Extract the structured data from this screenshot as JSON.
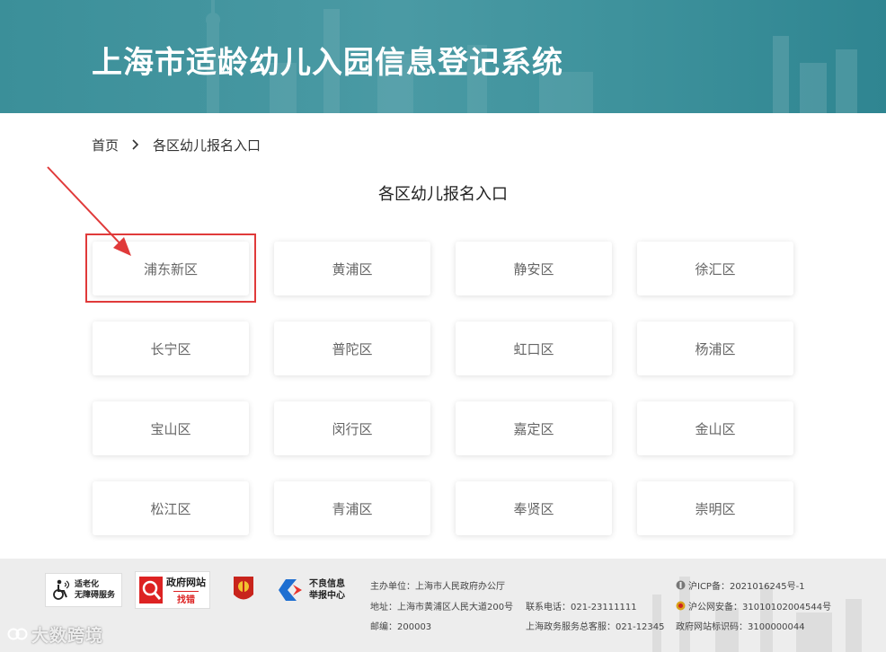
{
  "header": {
    "title": "上海市适龄幼儿入园信息登记系统"
  },
  "breadcrumb": {
    "home": "首页",
    "current": "各区幼儿报名入口"
  },
  "section_title": "各区幼儿报名入口",
  "districts": [
    "浦东新区",
    "黄浦区",
    "静安区",
    "徐汇区",
    "长宁区",
    "普陀区",
    "虹口区",
    "杨浦区",
    "宝山区",
    "闵行区",
    "嘉定区",
    "金山区",
    "松江区",
    "青浦区",
    "奉贤区",
    "崇明区"
  ],
  "annotation": {
    "highlight_color": "#e03a3a",
    "highlighted_district": "浦东新区"
  },
  "footer": {
    "badges": {
      "aging_line1": "适老化",
      "aging_line2": "无障碍服务",
      "gov_line1": "政府网站",
      "gov_line2": "找错",
      "report_line1": "不良信息",
      "report_line2": "举报中心"
    },
    "host": "主办单位：上海市人民政府办公厅",
    "address": "地址：上海市黄浦区人民大道200号",
    "phone": "联系电话：021-23111111",
    "zip": "邮编：200003",
    "hotline": "上海政务服务总客服：021-12345",
    "icp": "沪ICP备：2021016245号-1",
    "police": "沪公网安备：31010102004544号",
    "site_id": "政府网站标识码：3100000044"
  },
  "watermark": "大数跨境",
  "colors": {
    "banner": "#3e929c",
    "footer_bg": "#ededed",
    "card_text": "#666666"
  }
}
